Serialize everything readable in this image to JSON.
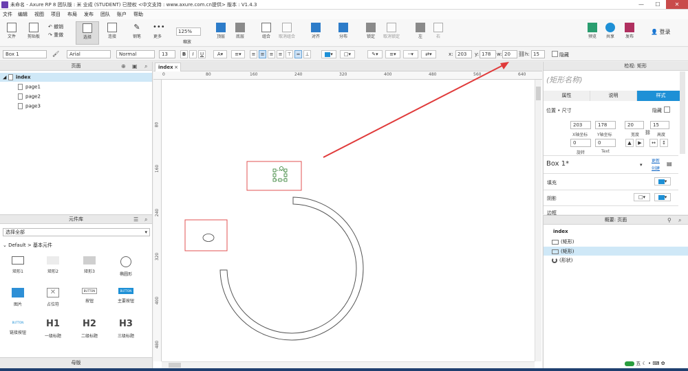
{
  "window": {
    "title": "未命名 - Axure RP 8 团队版 : 米 业成 (STUDENT) 已授权    <中文支持 : www.axure.com.cn提供> 版本 : V1.4.3",
    "controls": [
      "—",
      "☐",
      "✕"
    ]
  },
  "menu": [
    "文件",
    "编辑",
    "视图",
    "项目",
    "布局",
    "发布",
    "团队",
    "账户",
    "帮助"
  ],
  "toolbar": {
    "file": "文件",
    "clipboard": "剪贴板",
    "undo": "撤销",
    "redo": "重做",
    "select": "选择",
    "connect": "连接",
    "pen": "钢笔",
    "more": "更多",
    "zoom_value": "125%",
    "zoom_label": "缩放",
    "top": "顶层",
    "bottom": "底层",
    "group": "组合",
    "ungroup": "取消组合",
    "align": "对齐",
    "distribute": "分布",
    "lock": "锁定",
    "unlock": "取消锁定",
    "left": "左",
    "right": "右",
    "preview": "预览",
    "share": "共享",
    "publish": "发布",
    "login": "登录",
    "colors": {
      "accent": "#1e90d6",
      "preview": "#2a9d6f",
      "share": "#1e90d6",
      "publish": "#b03060"
    }
  },
  "format": {
    "widget_name": "Box 1",
    "font": "Arial",
    "style": "Normal",
    "size": "13",
    "x_label": "x:",
    "x": "203",
    "y_label": "y:",
    "y": "178",
    "w_label": "w:",
    "w": "20",
    "h_label": "h:",
    "h": "15",
    "hidden": "隐藏"
  },
  "pages_panel": {
    "title": "页面",
    "root": "index",
    "pages": [
      "page1",
      "page2",
      "page3"
    ]
  },
  "library_panel": {
    "title": "元件库",
    "select": "选择全部",
    "path": "Default > 基本元件",
    "items": [
      "矩形1",
      "矩形2",
      "矩形3",
      "椭圆形",
      "图片",
      "占位符",
      "按钮",
      "主要按钮",
      "链接按钮",
      "一级标题",
      "二级标题",
      "三级标题"
    ],
    "icon_texts": [
      "BUTTON",
      "BUTTON",
      "BUTTON",
      "H1",
      "H2",
      "H3"
    ]
  },
  "masters_panel": {
    "title": "母版"
  },
  "canvas": {
    "tab": "index",
    "hruler": [
      "0",
      "80",
      "160",
      "240",
      "320",
      "400",
      "480",
      "560",
      "640"
    ],
    "vruler": [
      "80",
      "160",
      "240",
      "320",
      "400",
      "480"
    ]
  },
  "inspector": {
    "title": "检视: 矩形",
    "name_placeholder": "(矩形名称)",
    "tabs": [
      "属性",
      "说明",
      "样式"
    ],
    "position_size": "位置 • 尺寸",
    "hidden": "隐藏",
    "x": "203",
    "y": "178",
    "w": "20",
    "h": "15",
    "x_label": "X轴坐标",
    "y_label": "Y轴坐标",
    "w_label": "宽度",
    "h_label": "高度",
    "rotate": "0",
    "text_rotate": "0",
    "rotate_label": "旋转",
    "text_label": "Text",
    "style_name": "Box 1*",
    "update": "更新",
    "create": "创建",
    "fill": "填充",
    "shadow": "阴影",
    "border": "边框"
  },
  "outline": {
    "title": "概要: 页面",
    "root": "index",
    "items": [
      "(矩形)",
      "(矩形)",
      "(形状)"
    ]
  },
  "tray": [
    "五"
  ]
}
